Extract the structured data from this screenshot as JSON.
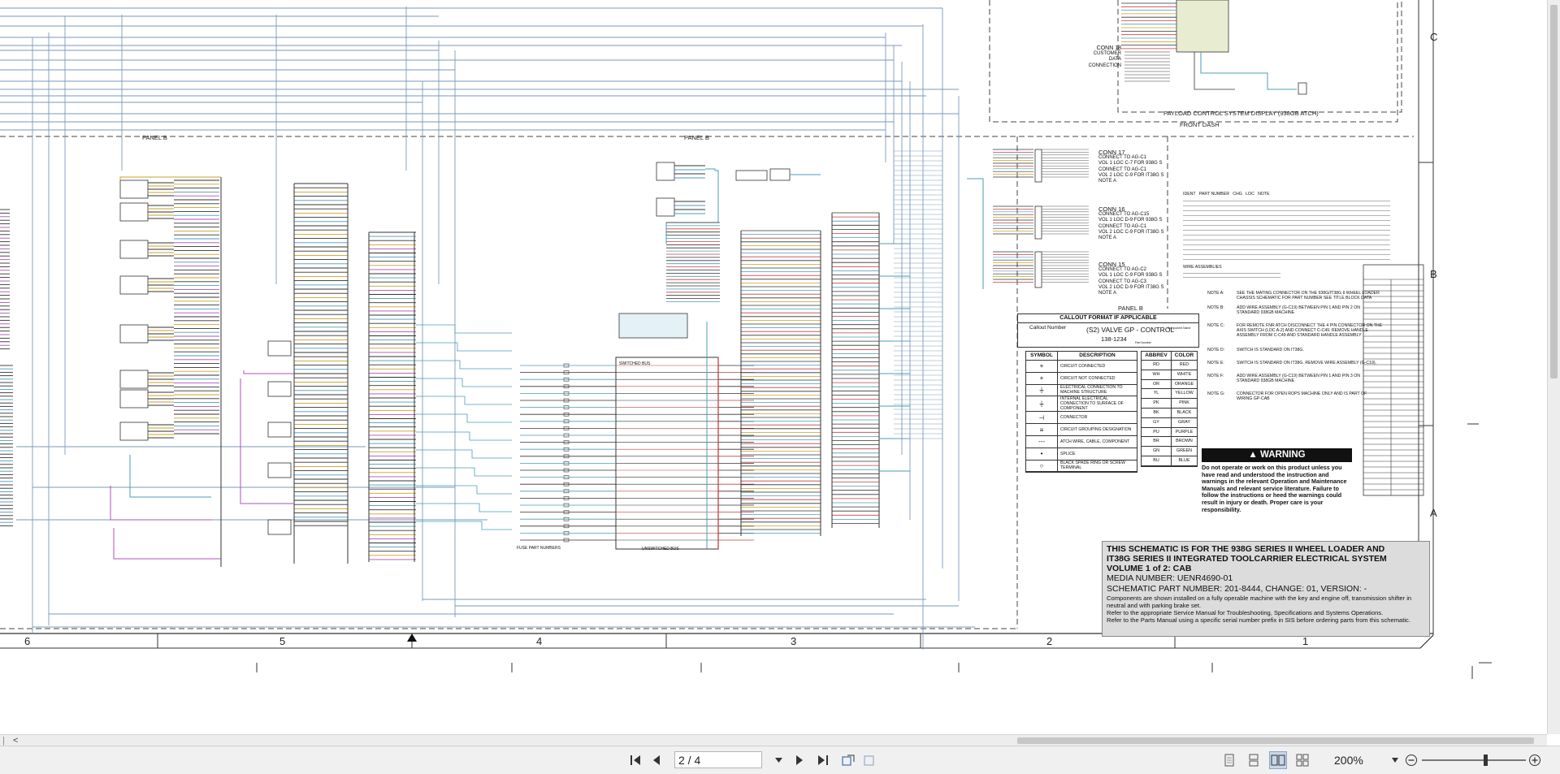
{
  "document": {
    "panels": {
      "panel_b_left": "PANEL B",
      "panel_b_center": "PANEL B",
      "panel_b_right": "PANEL B"
    },
    "front_dash": "FRONT DASH",
    "payload_display": "PAYLOAD CONTROL SYSTEM DISPLAY (938GB ATCH)",
    "zone_numbers": [
      "6",
      "5",
      "4",
      "3",
      "2",
      "1"
    ],
    "row_letters": [
      "C",
      "B",
      "A"
    ],
    "connectors": [
      {
        "title": "CONN 17",
        "lines": [
          "CONNECT TO AG-C1",
          "VOL 1 LOC C-7 FOR 938G S",
          "CONNECT TO AG-C1",
          "VOL 2 LOC C-9 FOR IT38G S",
          "NOTE A"
        ]
      },
      {
        "title": "CONN 16",
        "lines": [
          "CONNECT TO AG-C15",
          "VOL 1 LOC D-9 FOR 938G S",
          "CONNECT TO AG-C1",
          "VOL 2 LOC C-9 FOR IT38G S",
          "NOTE A"
        ]
      },
      {
        "title": "CONN 15",
        "lines": [
          "CONNECT TO AG-C2",
          "VOL 1 LOC C-9 FOR 938G S",
          "CONNECT TO AG-C3",
          "VOL 2 LOC D-9 FOR IT38G S",
          "NOTE A"
        ]
      }
    ],
    "conn18": [
      "CONN 18",
      "CUSTOMER",
      "DATA",
      "CONNECTION"
    ],
    "callout": {
      "header": "CALLOUT FORMAT IF APPLICABLE",
      "callout_number": "Callout Number",
      "example": "(S2) VALVE GP - CONTROL",
      "part": "138-1234",
      "component_name": "Component Name",
      "part_number": "Part Number"
    },
    "legend": {
      "symbol_header": "SYMBOL",
      "desc_header": "DESCRIPTION",
      "rows": [
        {
          "symbol": "+",
          "desc": "CIRCUIT CONNECTED"
        },
        {
          "symbol": "+",
          "desc": "CIRCUIT NOT CONNECTED"
        },
        {
          "symbol": "⏚",
          "desc": "ELECTRICAL CONNECTION TO MACHINE STRUCTURE"
        },
        {
          "symbol": "⏚",
          "desc": "INTERNAL ELECTRICAL CONNECTION TO SURFACE OF COMPONENT"
        },
        {
          "symbol": "⊣",
          "desc": "CONNECTOR"
        },
        {
          "symbol": "≡",
          "desc": "CIRCUIT GROUPING DESIGNATION"
        },
        {
          "symbol": "---",
          "desc": "ATCH WIRE, CABLE, COMPONENT"
        },
        {
          "symbol": "•",
          "desc": "SPLICE"
        },
        {
          "symbol": "○",
          "desc": "BLACK SPADE RING OR SCREW TERMINAL"
        }
      ]
    },
    "colors": {
      "abbrev_header": "ABBREV",
      "color_header": "COLOR",
      "rows": [
        [
          "RD",
          "RED"
        ],
        [
          "WH",
          "WHITE"
        ],
        [
          "OR",
          "ORANGE"
        ],
        [
          "YL",
          "YELLOW"
        ],
        [
          "PK",
          "PINK"
        ],
        [
          "BK",
          "BLACK"
        ],
        [
          "GY",
          "GRAY"
        ],
        [
          "PU",
          "PURPLE"
        ],
        [
          "BR",
          "BROWN"
        ],
        [
          "GN",
          "GREEN"
        ],
        [
          "BU",
          "BLUE"
        ]
      ]
    },
    "warning": {
      "title": "WARNING",
      "text": "Do not operate or work on this product unless you have read and understood the instruction and warnings in the relevant Operation and Maintenance Manuals and relevant service literature. Failure to follow the instructions or heed the warnings could result in injury or death. Proper care is your responsibility."
    },
    "notes_header": "IDENT   PART NUMBER   CHG   LOC   NOTE",
    "wire_assemblies": "WIRE ASSEMBLIES",
    "notes": [
      {
        "label": "NOTE A:",
        "text": "SEE THE MATING CONNECTOR ON THE 938G/IT38G II WHEEL LOADER CHASSIS SCHEMATIC FOR PART NUMBER SEE TITLE BLOCK DATA"
      },
      {
        "label": "NOTE B:",
        "text": "ADD WIRE ASSEMBLY (G-C19) BETWEEN PIN 1 AND PIN 2 ON STANDARD 938GB MACHINE"
      },
      {
        "label": "NOTE C:",
        "text": "FOR REMOTE FNR ATCH DISCONNECT THE 4 PIN CONNECTOR ON THE AXIS SWITCH (LOC A-2) AND CONNECT C-C49. REMOVE HANDLE ASSEMBLY FROM C-C49 AND STANDARD HANDLE ASSEMBLY"
      },
      {
        "label": "NOTE D:",
        "text": "SWITCH IS STANDARD ON IT38G."
      },
      {
        "label": "NOTE E:",
        "text": "SWITCH IS STANDARD ON IT38G. REMOVE WIRE ASSEMBLY (G-C19)."
      },
      {
        "label": "NOTE F:",
        "text": "ADD WIRE ASSEMBLY (G-C19) BETWEEN PIN 1 AND PIN 3 ON STANDARD 938GB MACHINE"
      },
      {
        "label": "NOTE G:",
        "text": "CONNECTOR FOR OPEN ROPS MACHINE ONLY AND IS PART OF WIRING GP-CAB"
      }
    ],
    "title_block": {
      "line1": "THIS SCHEMATIC IS FOR THE 938G SERIES II WHEEL LOADER AND",
      "line2": "IT38G SERIES II INTEGRATED TOOLCARRIER ELECTRICAL SYSTEM",
      "line3": "VOLUME 1 of 2: CAB",
      "media": "MEDIA NUMBER: UENR4690-01",
      "part": "SCHEMATIC PART NUMBER: 201-8444, CHANGE: 01, VERSION: -",
      "small1": "Components are shown installed on a fully operable machine with the key and engine off, transmission shifter in neutral and with parking brake set.",
      "small2": "Refer to the appropriate Service Manual for Troubleshooting, Specifications and Systems Operations.",
      "small3": "Refer to the Parts Manual using a specific serial number prefix in SIS before ordering parts from this schematic."
    },
    "fuse_labels": [
      "SWITCHED BUS",
      "UNSWITCHED BUS",
      "FUSE PART NUMBERS"
    ]
  },
  "toolbar": {
    "page_value": "2 / 4",
    "zoom_value": "200%",
    "scroll_left": "<",
    "collapse_marker": "|"
  },
  "icons": [
    "first-page-icon",
    "prev-page-icon",
    "next-page-icon",
    "last-page-icon",
    "rotate-icon",
    "fit-icon",
    "single-page-icon",
    "continuous-icon",
    "two-page-icon",
    "scroll-view-icon",
    "zoom-out-icon",
    "zoom-in-icon"
  ]
}
